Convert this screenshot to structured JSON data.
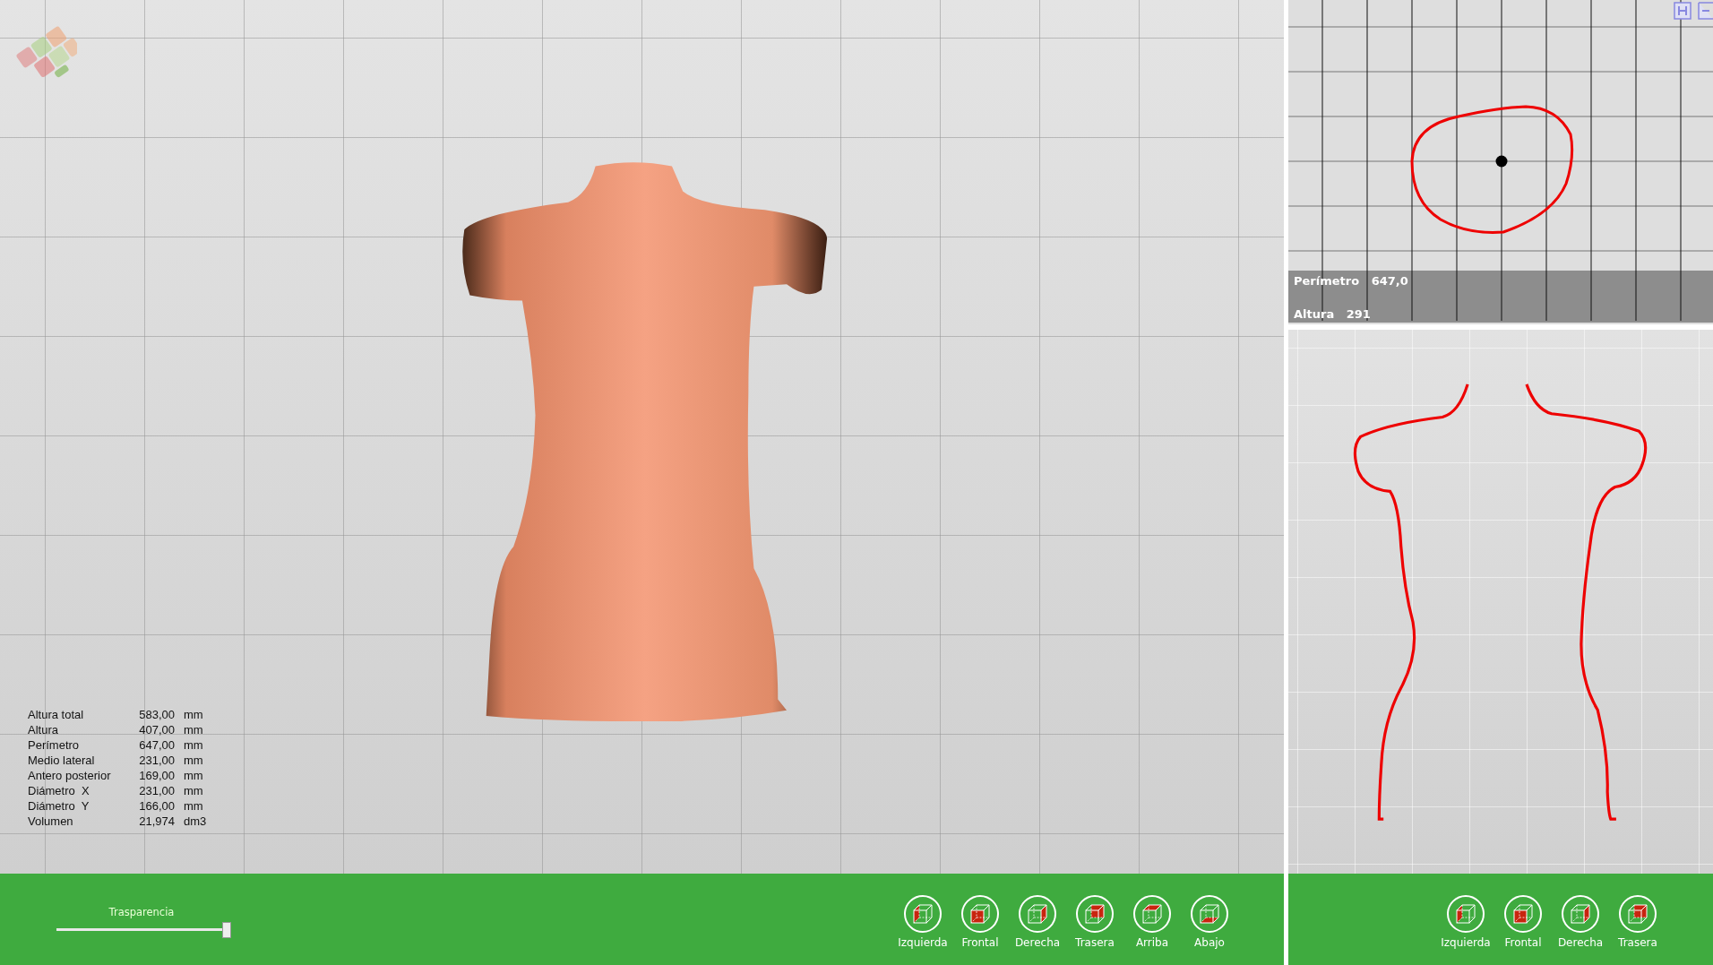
{
  "measurements": [
    {
      "label": "Altura total",
      "value": "583,00",
      "unit": "mm"
    },
    {
      "label": "Altura",
      "value": "407,00",
      "unit": "mm"
    },
    {
      "label": "Perímetro",
      "value": "647,00",
      "unit": "mm"
    },
    {
      "label": "Medio lateral",
      "value": "231,00",
      "unit": "mm"
    },
    {
      "label": "Antero posterior",
      "value": "169,00",
      "unit": "mm"
    },
    {
      "label": "Diámetro  X",
      "value": "231,00",
      "unit": "mm"
    },
    {
      "label": "Diámetro  Y",
      "value": "166,00",
      "unit": "mm"
    },
    {
      "label": "Volumen",
      "value": "21,974",
      "unit": "dm3"
    }
  ],
  "transparency_slider": {
    "label": "Trasparencia",
    "level": 1.0
  },
  "main_view_buttons": [
    {
      "label": "Izquierda",
      "kind": "left"
    },
    {
      "label": "Frontal",
      "kind": "front"
    },
    {
      "label": "Derecha",
      "kind": "right"
    },
    {
      "label": "Trasera",
      "kind": "back"
    },
    {
      "label": "Arriba",
      "kind": "top"
    },
    {
      "label": "Abajo",
      "kind": "bottom"
    }
  ],
  "section_view": {
    "perimeter_label": "Perímetro",
    "perimeter_value": "647,0",
    "height_label": "Altura",
    "height_value": "291"
  },
  "profile_view_buttons": [
    {
      "label": "Izquierda",
      "kind": "left"
    },
    {
      "label": "Frontal",
      "kind": "front"
    },
    {
      "label": "Derecha",
      "kind": "right"
    },
    {
      "label": "Trasera",
      "kind": "back"
    }
  ]
}
